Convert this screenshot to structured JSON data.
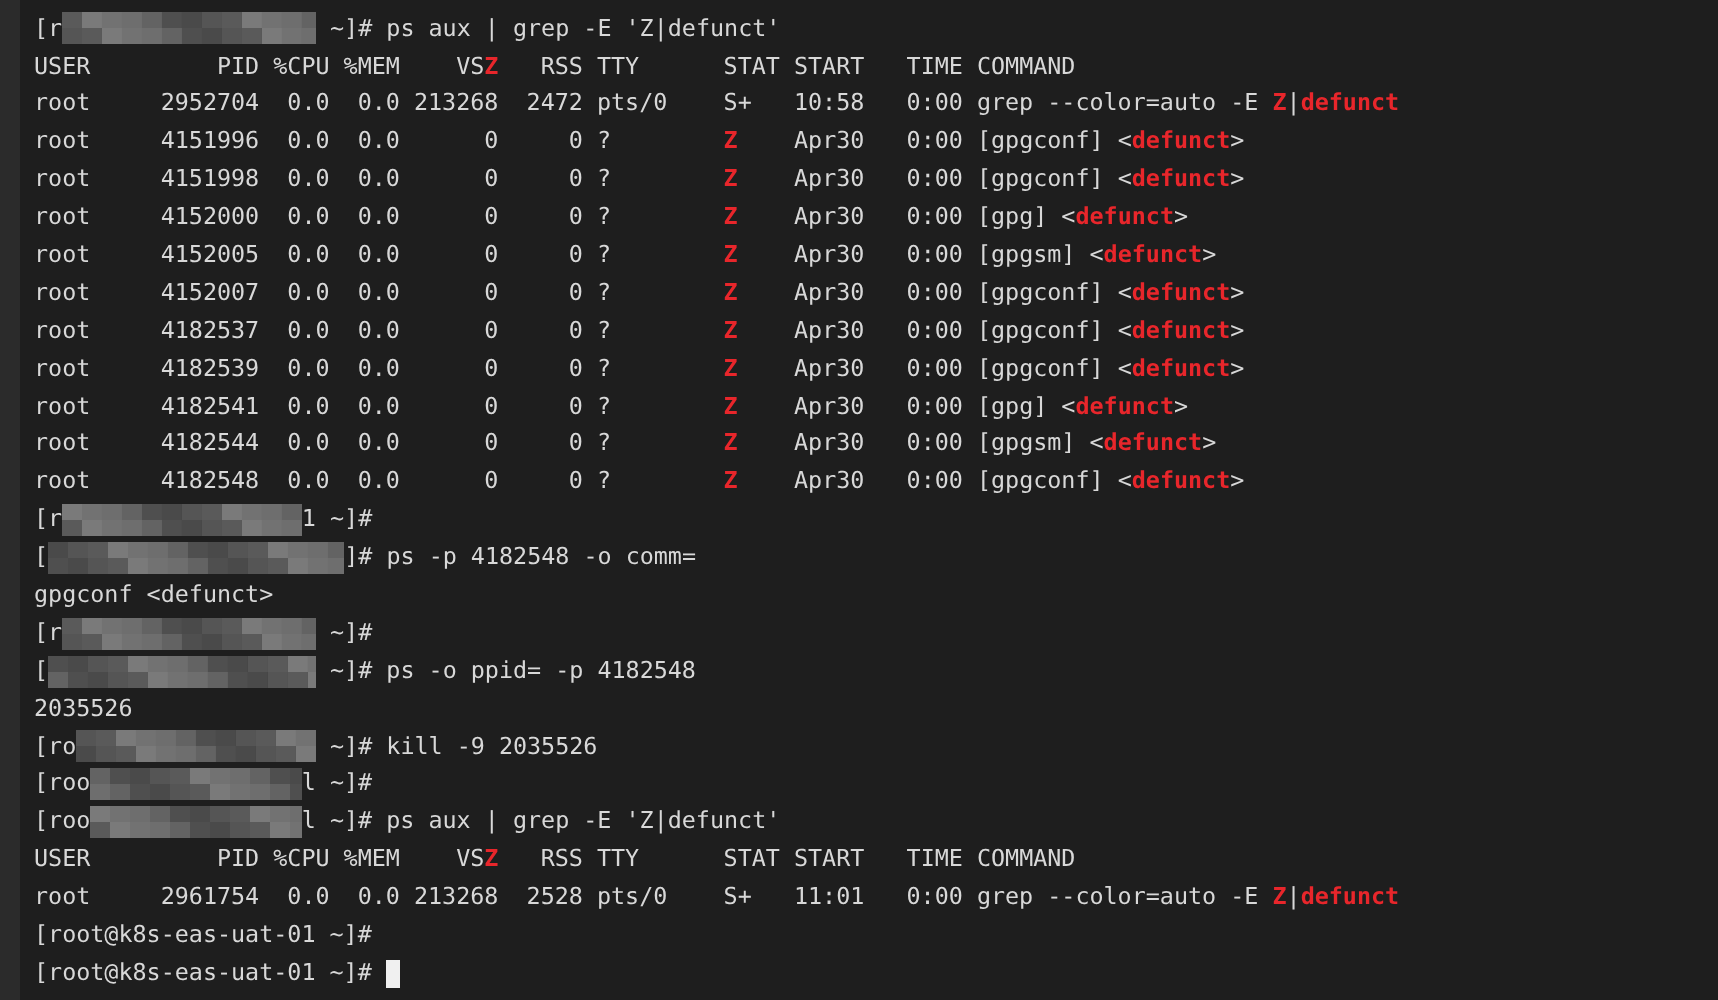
{
  "terminal": {
    "lines": [
      {
        "kind": "prompt",
        "start": "[r",
        "redacted": true,
        "end": " ~]#",
        "command": " ps aux | grep -E 'Z|defunct'"
      },
      {
        "kind": "output",
        "segments": [
          {
            "text": "USER         PID %CPU %MEM    VS",
            "match": false
          },
          {
            "text": "Z",
            "match": true
          },
          {
            "text": "   RSS TTY      STAT START   TIME COMMAND",
            "match": false
          }
        ]
      },
      {
        "kind": "output",
        "segments": [
          {
            "text": "root     2952704  0.0  0.0 213268  2472 pts/0    S+   10:58   0:00 grep --color=auto -E ",
            "match": false
          },
          {
            "text": "Z",
            "match": true
          },
          {
            "text": "|",
            "match": false
          },
          {
            "text": "defunct",
            "match": true
          }
        ]
      },
      {
        "kind": "output",
        "segments": [
          {
            "text": "root     4151996  0.0  0.0      0     0 ?        ",
            "match": false
          },
          {
            "text": "Z",
            "match": true
          },
          {
            "text": "    Apr30   0:00 [gpgconf] <",
            "match": false
          },
          {
            "text": "defunct",
            "match": true
          },
          {
            "text": ">",
            "match": false
          }
        ]
      },
      {
        "kind": "output",
        "segments": [
          {
            "text": "root     4151998  0.0  0.0      0     0 ?        ",
            "match": false
          },
          {
            "text": "Z",
            "match": true
          },
          {
            "text": "    Apr30   0:00 [gpgconf] <",
            "match": false
          },
          {
            "text": "defunct",
            "match": true
          },
          {
            "text": ">",
            "match": false
          }
        ]
      },
      {
        "kind": "output",
        "segments": [
          {
            "text": "root     4152000  0.0  0.0      0     0 ?        ",
            "match": false
          },
          {
            "text": "Z",
            "match": true
          },
          {
            "text": "    Apr30   0:00 [gpg] <",
            "match": false
          },
          {
            "text": "defunct",
            "match": true
          },
          {
            "text": ">",
            "match": false
          }
        ]
      },
      {
        "kind": "output",
        "segments": [
          {
            "text": "root     4152005  0.0  0.0      0     0 ?        ",
            "match": false
          },
          {
            "text": "Z",
            "match": true
          },
          {
            "text": "    Apr30   0:00 [gpgsm] <",
            "match": false
          },
          {
            "text": "defunct",
            "match": true
          },
          {
            "text": ">",
            "match": false
          }
        ]
      },
      {
        "kind": "output",
        "segments": [
          {
            "text": "root     4152007  0.0  0.0      0     0 ?        ",
            "match": false
          },
          {
            "text": "Z",
            "match": true
          },
          {
            "text": "    Apr30   0:00 [gpgconf] <",
            "match": false
          },
          {
            "text": "defunct",
            "match": true
          },
          {
            "text": ">",
            "match": false
          }
        ]
      },
      {
        "kind": "output",
        "segments": [
          {
            "text": "root     4182537  0.0  0.0      0     0 ?        ",
            "match": false
          },
          {
            "text": "Z",
            "match": true
          },
          {
            "text": "    Apr30   0:00 [gpgconf] <",
            "match": false
          },
          {
            "text": "defunct",
            "match": true
          },
          {
            "text": ">",
            "match": false
          }
        ]
      },
      {
        "kind": "output",
        "segments": [
          {
            "text": "root     4182539  0.0  0.0      0     0 ?        ",
            "match": false
          },
          {
            "text": "Z",
            "match": true
          },
          {
            "text": "    Apr30   0:00 [gpgconf] <",
            "match": false
          },
          {
            "text": "defunct",
            "match": true
          },
          {
            "text": ">",
            "match": false
          }
        ]
      },
      {
        "kind": "output",
        "segments": [
          {
            "text": "root     4182541  0.0  0.0      0     0 ?        ",
            "match": false
          },
          {
            "text": "Z",
            "match": true
          },
          {
            "text": "    Apr30   0:00 [gpg] <",
            "match": false
          },
          {
            "text": "defunct",
            "match": true
          },
          {
            "text": ">",
            "match": false
          }
        ]
      },
      {
        "kind": "output",
        "segments": [
          {
            "text": "root     4182544  0.0  0.0      0     0 ?        ",
            "match": false
          },
          {
            "text": "Z",
            "match": true
          },
          {
            "text": "    Apr30   0:00 [gpgsm] <",
            "match": false
          },
          {
            "text": "defunct",
            "match": true
          },
          {
            "text": ">",
            "match": false
          }
        ]
      },
      {
        "kind": "output",
        "segments": [
          {
            "text": "root     4182548  0.0  0.0      0     0 ?        ",
            "match": false
          },
          {
            "text": "Z",
            "match": true
          },
          {
            "text": "    Apr30   0:00 [gpgconf] <",
            "match": false
          },
          {
            "text": "defunct",
            "match": true
          },
          {
            "text": ">",
            "match": false
          }
        ]
      },
      {
        "kind": "prompt",
        "start": "[r",
        "redacted": true,
        "end": "1 ~]#"
      },
      {
        "kind": "prompt",
        "start": "[",
        "redacted": true,
        "end": "]#",
        "command": " ps -p 4182548 -o comm="
      },
      {
        "kind": "output",
        "segments": [
          {
            "text": "gpgconf <defunct>",
            "match": false
          }
        ]
      },
      {
        "kind": "prompt",
        "start": "[r",
        "redacted": true,
        "end": " ~]#"
      },
      {
        "kind": "prompt",
        "start": "[",
        "redacted": true,
        "end": " ~]#",
        "command": " ps -o ppid= -p 4182548"
      },
      {
        "kind": "output",
        "segments": [
          {
            "text": "2035526",
            "match": false
          }
        ]
      },
      {
        "kind": "prompt",
        "start": "[ro",
        "redacted": true,
        "end": " ~]#",
        "command": " kill -9 2035526"
      },
      {
        "kind": "prompt",
        "start": "[roo",
        "redacted": true,
        "end": "l ~]#"
      },
      {
        "kind": "prompt",
        "start": "[roo",
        "redacted": true,
        "end": "l ~]#",
        "command": " ps aux | grep -E 'Z|defunct'"
      },
      {
        "kind": "output",
        "segments": [
          {
            "text": "USER         PID %CPU %MEM    VS",
            "match": false
          },
          {
            "text": "Z",
            "match": true
          },
          {
            "text": "   RSS TTY      STAT START   TIME COMMAND",
            "match": false
          }
        ]
      },
      {
        "kind": "output",
        "segments": [
          {
            "text": "root     2961754  0.0  0.0 213268  2528 pts/0    S+   11:01   0:00 grep --color=auto -E ",
            "match": false
          },
          {
            "text": "Z",
            "match": true
          },
          {
            "text": "|",
            "match": false
          },
          {
            "text": "defunct",
            "match": true
          }
        ]
      },
      {
        "kind": "prompt",
        "start": "[root@k8s-eas-uat-01 ~]#",
        "redacted": false
      },
      {
        "kind": "prompt",
        "start": "[root@k8s-eas-uat-01 ~]#",
        "redacted": false,
        "cursor": true
      }
    ]
  }
}
